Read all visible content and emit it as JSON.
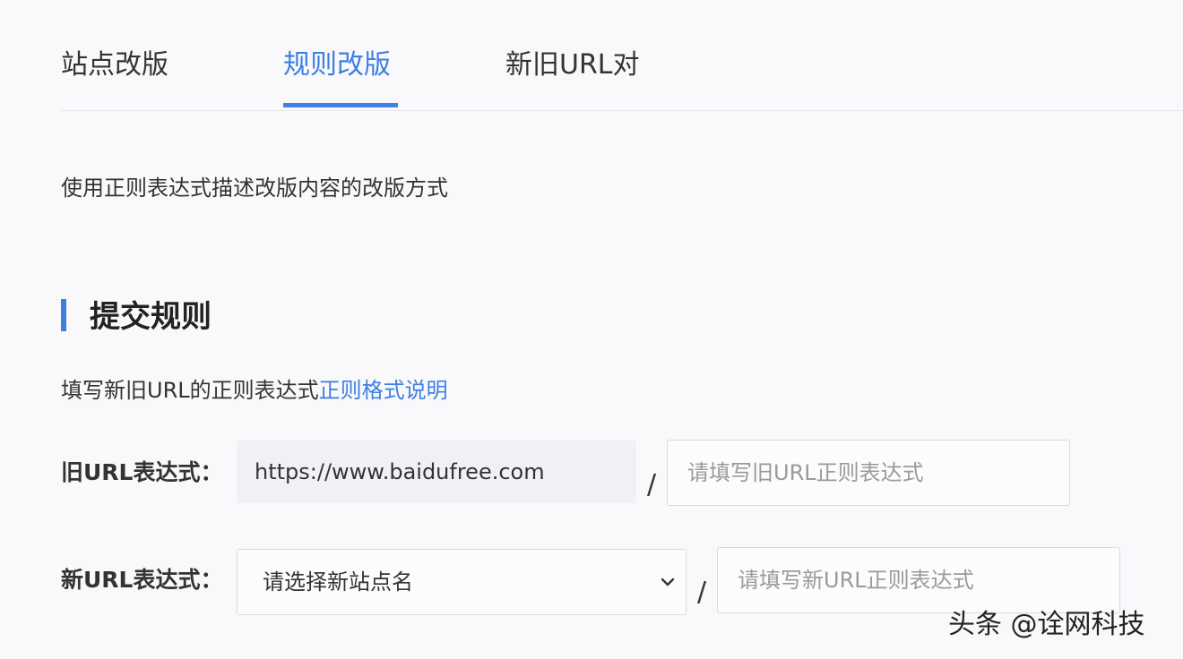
{
  "tabs": [
    {
      "label": "站点改版",
      "active": false
    },
    {
      "label": "规则改版",
      "active": true
    },
    {
      "label": "新旧URL对",
      "active": false
    }
  ],
  "description": "使用正则表达式描述改版内容的改版方式",
  "section": {
    "title": "提交规则",
    "hint_text": "填写新旧URL的正则表达式",
    "hint_link": "正则格式说明"
  },
  "old_url": {
    "label": "旧URL表达式：",
    "domain_value": "https://www.baidufree.com",
    "separator": "/",
    "placeholder": "请填写旧URL正则表达式"
  },
  "new_url": {
    "label": "新URL表达式：",
    "select_value": "请选择新站点名",
    "separator": "/",
    "placeholder": "请填写新URL正则表达式"
  },
  "watermark": "头条 @诠网科技",
  "colors": {
    "accent": "#3d7fe2",
    "text": "#333333",
    "placeholder": "#9a9a9a",
    "border": "#d9dbe0",
    "readonly_bg": "#f0f1f5"
  },
  "icons": {
    "select_chevron": "chevron-down-icon"
  }
}
